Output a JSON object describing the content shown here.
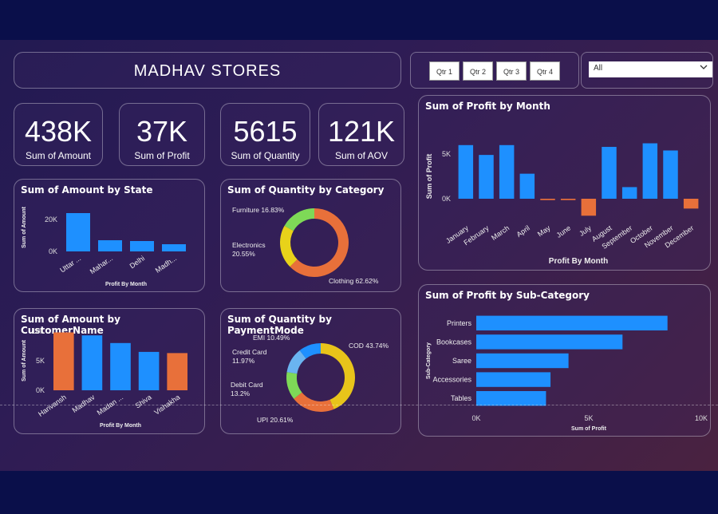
{
  "header": {
    "title": "MADHAV  STORES"
  },
  "filters": {
    "quarters": [
      "Qtr 1",
      "Qtr 2",
      "Qtr 3",
      "Qtr 4"
    ],
    "dropdown_value": "All"
  },
  "kpis": [
    {
      "value": "438K",
      "label": "Sum of Amount"
    },
    {
      "value": "37K",
      "label": "Sum of Profit"
    },
    {
      "value": "5615",
      "label": "Sum of Quantity"
    },
    {
      "value": "121K",
      "label": "Sum of AOV"
    }
  ],
  "colors": {
    "blue": "#1e90ff",
    "orange": "#e8703a",
    "yellow": "#e8d21a",
    "green": "#7ed957",
    "lightblue": "#6ab4f0",
    "red": "#e05a3a"
  },
  "chart_data": [
    {
      "id": "state",
      "type": "bar",
      "title": "Sum of Amount by State",
      "categories": [
        "Uttar ...",
        "Mahar...",
        "Delhi",
        "Madh..."
      ],
      "values": [
        24000,
        7000,
        6500,
        4500
      ],
      "xlabel": "Profit By Month",
      "ylabel": "Sum of Amount",
      "ylim": [
        0,
        30000
      ],
      "ticks": [
        {
          "v": 0,
          "label": "0K"
        },
        {
          "v": 20000,
          "label": "20K"
        }
      ]
    },
    {
      "id": "category",
      "type": "pie",
      "title": "Sum of Quantity by Category",
      "slices": [
        {
          "label": "Clothing 62.62%",
          "value": 62.62,
          "color": "#e8703a"
        },
        {
          "label": "Electronics 20.55%",
          "value": 20.55,
          "color": "#e8d21a"
        },
        {
          "label": "Furniture 16.83%",
          "value": 16.83,
          "color": "#7ed957"
        }
      ]
    },
    {
      "id": "customer",
      "type": "bar",
      "title": "Sum of Amount by CustomerName",
      "categories": [
        "Harivansh",
        "Madhav",
        "Madan ...",
        "Shiva",
        "Vishakha"
      ],
      "values": [
        9800,
        9300,
        8000,
        6500,
        6300
      ],
      "colors": [
        "#e8703a",
        "#1e90ff",
        "#1e90ff",
        "#1e90ff",
        "#e8703a"
      ],
      "xlabel": "Profit By Month",
      "ylabel": "Sum of Amount",
      "ylim": [
        0,
        10000
      ],
      "ticks": [
        {
          "v": 0,
          "label": "0K"
        },
        {
          "v": 5000,
          "label": "5K"
        },
        {
          "v": 10000,
          "label": "10K"
        }
      ]
    },
    {
      "id": "payment",
      "type": "pie",
      "title": "Sum of Quantity by PaymentMode",
      "slices": [
        {
          "label": "COD 43.74%",
          "value": 43.74,
          "color": "#e8c41a"
        },
        {
          "label": "UPI 20.61%",
          "value": 20.61,
          "color": "#e8703a"
        },
        {
          "label": "Debit Card 13.2%",
          "value": 13.2,
          "color": "#7ed957"
        },
        {
          "label": "Credit Card 11.97%",
          "value": 11.97,
          "color": "#6ab4f0"
        },
        {
          "label": "EMI 10.49%",
          "value": 10.49,
          "color": "#1e90ff"
        }
      ]
    },
    {
      "id": "month",
      "type": "bar",
      "title": "Sum of Profit by Month",
      "categories": [
        "January",
        "February",
        "March",
        "April",
        "May",
        "June",
        "July",
        "August",
        "September",
        "October",
        "November",
        "December"
      ],
      "values": [
        6000,
        4900,
        6000,
        2800,
        -150,
        -150,
        -1900,
        5800,
        1300,
        6200,
        5400,
        -1100
      ],
      "xlabel": "Profit By Month",
      "ylabel": "Sum of Profit",
      "ylim": [
        -2500,
        7500
      ],
      "ticks": [
        {
          "v": 0,
          "label": "0K"
        },
        {
          "v": 5000,
          "label": "5K"
        }
      ]
    },
    {
      "id": "subcat",
      "type": "bar",
      "title": "Sum of Profit by Sub-Category",
      "categories": [
        "Printers",
        "Bookcases",
        "Saree",
        "Accessories",
        "Tables"
      ],
      "values": [
        8500,
        6500,
        4100,
        3300,
        3100
      ],
      "xlabel": "Sum of Profit",
      "ylabel": "Sub-Category",
      "xlim": [
        0,
        10000
      ],
      "ticks": [
        {
          "v": 0,
          "label": "0K"
        },
        {
          "v": 5000,
          "label": "5K"
        },
        {
          "v": 10000,
          "label": "10K"
        }
      ]
    }
  ]
}
